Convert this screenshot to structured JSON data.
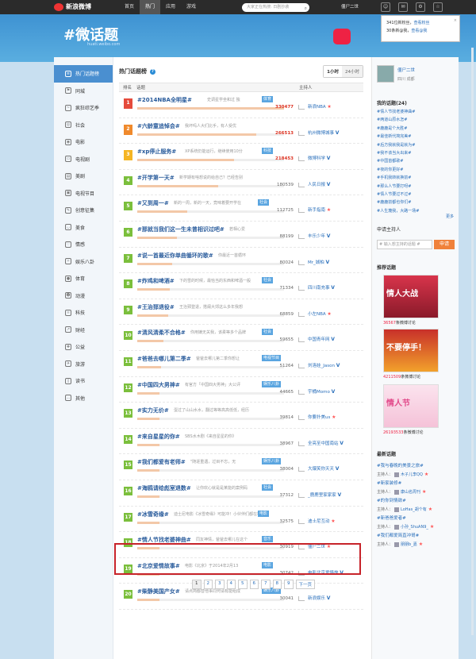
{
  "topbar": {
    "logo": "新浪微博",
    "nav": [
      "首页",
      "热门",
      "应用",
      "游戏"
    ],
    "search_placeholder": "大家正在热搜: 日剧抄袭",
    "user": "僵尸二世",
    "icons": [
      "user-icon",
      "mail-icon",
      "gear-icon",
      "star-icon"
    ]
  },
  "notice": {
    "line1": "341位新粉丝，",
    "line1_link": "查看粉丝",
    "line2": "30条新@我，",
    "line2_link": "查看@我"
  },
  "banner": {
    "brand": "#微话题",
    "sub": "huati.weibo.com"
  },
  "sidebar": {
    "items": [
      "热门话题榜",
      "同城",
      "疯狂综艺季",
      "社会",
      "电影",
      "电视剧",
      "美剧",
      "电视节目",
      "创意征集",
      "美食",
      "情感",
      "娱乐八卦",
      "体育",
      "动漫",
      "科技",
      "财经",
      "公益",
      "旅游",
      "读书",
      "其他"
    ]
  },
  "main": {
    "title": "热门话题榜",
    "tabs": [
      "1小时",
      "24小时"
    ],
    "col_rank": "排名",
    "col_topic": "话题",
    "col_host": "主持人",
    "rows": [
      {
        "rank": "1",
        "title": "#2014NBA全明星#",
        "desc": "史调星学坐和过 独",
        "tag": "体育",
        "count": "330477",
        "host": "新浪NBA"
      },
      {
        "rank": "2",
        "title": "#六龄童追悼会#",
        "desc": "我坏吗人大们比手，有人受优",
        "tag": "",
        "count": "266513",
        "host": "杭州微博城事"
      },
      {
        "rank": "3",
        "title": "#xp停止服务#",
        "desc": "XP系统仍能运行，继续使用10分",
        "tag": "科技",
        "count": "218453",
        "host": "微博科学"
      },
      {
        "rank": "4",
        "title": "#开学第一天#",
        "desc": "新学期有啥想说的给自己？已经告别",
        "tag": "",
        "count": "180539",
        "host": "人民日报"
      },
      {
        "rank": "5",
        "title": "#又到周一#",
        "desc": "新的一周，新的一天，竟味着要开学在",
        "tag": "社会",
        "count": "112725",
        "host": "新手指南"
      },
      {
        "rank": "6",
        "title": "#那就当我们这一生未曾相识过吧#",
        "desc": "若相心爱",
        "tag": "",
        "count": "88199",
        "host": "丰乐少年"
      },
      {
        "rank": "7",
        "title": "#说一首最近你单曲循环的歌#",
        "desc": "你最近一首循环",
        "tag": "",
        "count": "80024",
        "host": "Mr_城柏"
      },
      {
        "rank": "8",
        "title": "#炸鸡和啤酒#",
        "desc": "下的雪的时候，最恰当的东西和啤酒一般",
        "tag": "社会",
        "count": "71334",
        "host": "四川南充事"
      },
      {
        "rank": "9",
        "title": "#王治郅退役#",
        "desc": "王治郅登退，搭阑大郊这么多年我想",
        "tag": "",
        "count": "68859",
        "host": "小左NBA"
      },
      {
        "rank": "10",
        "title": "#清风清柔不合格#",
        "desc": "你用嫡无关我，该柔等多个品牌",
        "tag": "社会",
        "count": "59655",
        "host": "中国青年网"
      },
      {
        "rank": "11",
        "title": "#爸爸去哪儿第二季#",
        "desc": "爸爸去哪儿第二季你想让",
        "tag": "电视节目",
        "count": "51264",
        "host": "刘洛娃_Jason"
      },
      {
        "rank": "12",
        "title": "#中国四大男神#",
        "desc": "有官方「中国四大男神」大公评",
        "tag": "娱乐八卦",
        "count": "44665",
        "host": "宇桶Momo"
      },
      {
        "rank": "13",
        "title": "#实力无价#",
        "desc": "蛋过了山山水水，翻过等等高高低低，经历",
        "tag": "",
        "count": "39814",
        "host": "你要扑美us"
      },
      {
        "rank": "14",
        "title": "#来自星星的你#",
        "desc": "SBS水木剧《来自星星的你》",
        "tag": "",
        "count": "38967",
        "host": "全亮至中国南站"
      },
      {
        "rank": "15",
        "title": "#我们都爱有老师#",
        "desc": "\"随逐重遇，过目不忘，无",
        "tag": "娱乐八卦",
        "count": "38004",
        "host": "大爆笑你天天"
      },
      {
        "rank": "16",
        "title": "#海鸥请给彪室退数#",
        "desc": "让你欢心就是是某能的案例码",
        "tag": "社会",
        "count": "37312",
        "host": "_鹿鹿里家家家"
      },
      {
        "rank": "17",
        "title": "#冰雪奇缘#",
        "desc": "迪士尼电影《冰雪奇缘》可能冲！小伙伴们都在等待",
        "tag": "电影",
        "count": "32575",
        "host": "迪士尼互动"
      },
      {
        "rank": "18",
        "title": "#情人节找老婆神曲#",
        "desc": "同友神情，爸爸去哪儿在这个",
        "tag": "音乐",
        "count": "30919",
        "host": "僵尸二世"
      },
      {
        "rank": "19",
        "title": "#北京爱情故事#",
        "desc": "电影《北京》于2014年2月13",
        "tag": "电影",
        "count": "30742",
        "host": "电影北京爱情故"
      },
      {
        "rank": "20",
        "title": "#柴静美国产女#",
        "desc": "请点简都替他事同何请有能组成",
        "tag": "娱乐八卦",
        "count": "30041",
        "host": "新浪娱乐"
      }
    ],
    "pager": [
      "1",
      "2",
      "3",
      "4",
      "5",
      "6",
      "7",
      "8",
      "9",
      "下一页"
    ]
  },
  "right": {
    "username": "僵尸二世",
    "location": "四川 成都",
    "my_topics_title": "我的话题(24)",
    "my_topics": [
      "#情人节找老婆神曲#",
      "#两道山原水怎#",
      "#鹿鹿是个大胜#",
      "#最佳新代简完美#",
      "#后方我就我是就为#",
      "#我不该当大出来#",
      "#中国首都歌#",
      "#夜的你更好#",
      "#手机我转就换前#",
      "#那么人节要打呀#",
      "#情人节要过不过#",
      "#鹿鹿前都也你们#",
      "#人生蔑我，大路一场#"
    ],
    "more": "更多",
    "apply_title": "申请主持人",
    "apply_placeholder": "# 输入想主持的话题 #",
    "apply_btn": "申请",
    "rec_title": "推荐话题",
    "promos": [
      {
        "text": "情人大战",
        "caption_n": "36567",
        "caption": "条微博讨论"
      },
      {
        "text": "不要停手！",
        "caption_n": "4211509",
        "caption": "条微博讨论"
      },
      {
        "text": "情人节",
        "caption_n": "26193533",
        "caption": "条微博讨论"
      }
    ],
    "new_title": "最新话题",
    "new_topics": [
      {
        "title": "#我与春晚的美景之旅#",
        "host": "木子儿李QQ"
      },
      {
        "title": "#新家装修#",
        "host": "康山名周刊"
      },
      {
        "title": "#的你到情欲#",
        "host": "LoHas_胡个有"
      },
      {
        "title": "#新爸爸爱者#",
        "host": "小孙_ShuAN9_"
      },
      {
        "title": "#我们都爱简直冲哥#",
        "host": "朋朋b_嘉"
      }
    ],
    "host_label": "主持人："
  }
}
